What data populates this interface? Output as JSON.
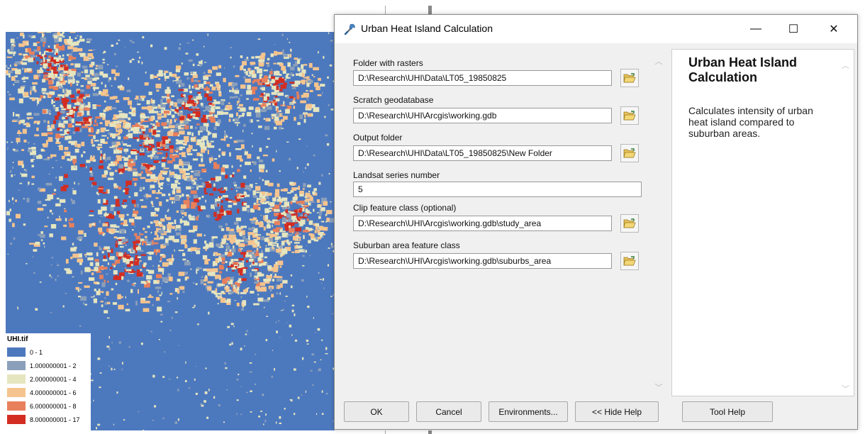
{
  "map": {
    "legend": {
      "title": "UHI.tif",
      "classes": [
        {
          "label": "0 - 1",
          "color": "#4c78be"
        },
        {
          "label": "1.000000001 - 2",
          "color": "#8a9fba"
        },
        {
          "label": "2.000000001 - 4",
          "color": "#e5e5bf"
        },
        {
          "label": "4.000000001 - 6",
          "color": "#f5c48e"
        },
        {
          "label": "6.000000001 - 8",
          "color": "#e8805c"
        },
        {
          "label": "8.000000001 - 17",
          "color": "#d32d22"
        }
      ]
    }
  },
  "dialog": {
    "title": "Urban Heat Island Calculation",
    "window_controls": {
      "minimize": "—",
      "maximize": "☐",
      "close": "✕"
    },
    "parameters": [
      {
        "label": "Folder with rasters",
        "value": "D:\\Research\\UHI\\Data\\LT05_19850825"
      },
      {
        "label": "Scratch geodatabase",
        "value": "D:\\Research\\UHI\\Arcgis\\working.gdb"
      },
      {
        "label": "Output folder",
        "value": "D:\\Research\\UHI\\Data\\LT05_19850825\\New Folder"
      },
      {
        "label": "Landsat series number",
        "value": "5"
      },
      {
        "label": "Clip feature class (optional)",
        "value": "D:\\Research\\UHI\\Arcgis\\working.gdb\\study_area"
      },
      {
        "label": "Suburban area feature class",
        "value": "D:\\Research\\UHI\\Arcgis\\working.gdb\\suburbs_area"
      }
    ],
    "help": {
      "title": "Urban Heat Island Calculation",
      "body": "Calculates intensity of urban heat island compared to suburban areas."
    },
    "buttons": {
      "ok": "OK",
      "cancel": "Cancel",
      "environments": "Environments...",
      "hide_help": "<< Hide Help",
      "tool_help": "Tool Help"
    }
  }
}
